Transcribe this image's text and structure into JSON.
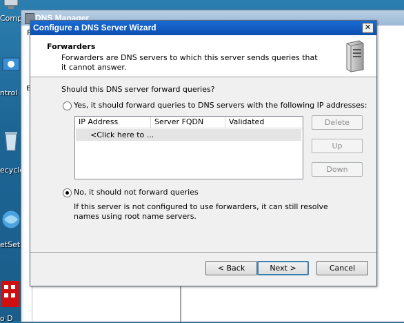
{
  "desktop": {
    "icons": [
      {
        "label": "Compu",
        "icon": "computer-icon"
      },
      {
        "label": "ntrol P",
        "icon": "control-panel-icon"
      },
      {
        "label": "ecycle",
        "icon": "recycle-bin-icon"
      },
      {
        "label": "etSet",
        "icon": "network-globe-icon"
      },
      {
        "label": "o D",
        "icon": "app-icon"
      }
    ]
  },
  "dns_manager": {
    "title": "DNS Manager",
    "menu_first": "F",
    "tree_letter": "E"
  },
  "wizard": {
    "title": "Configure a DNS Server Wizard",
    "close_label": "✕",
    "header": {
      "title": "Forwarders",
      "description": "Forwarders are DNS servers to which this server sends queries that it cannot answer.",
      "icon": "server-icon"
    },
    "question": "Should this DNS server forward queries?",
    "option_yes": {
      "label": "Yes, it should forward queries to DNS servers with the following IP addresses:",
      "selected": false
    },
    "option_no": {
      "label": "No, it should not forward queries",
      "selected": true,
      "description": "If this server is not configured to use forwarders, it can still resolve names using root name servers."
    },
    "list": {
      "columns": [
        "IP Address",
        "Server FQDN",
        "Validated"
      ],
      "rows": [
        "<Click here to ..."
      ]
    },
    "side_buttons": {
      "delete": "Delete",
      "up": "Up",
      "down": "Down"
    },
    "footer": {
      "back": "< Back",
      "next": "Next >",
      "cancel": "Cancel"
    }
  }
}
